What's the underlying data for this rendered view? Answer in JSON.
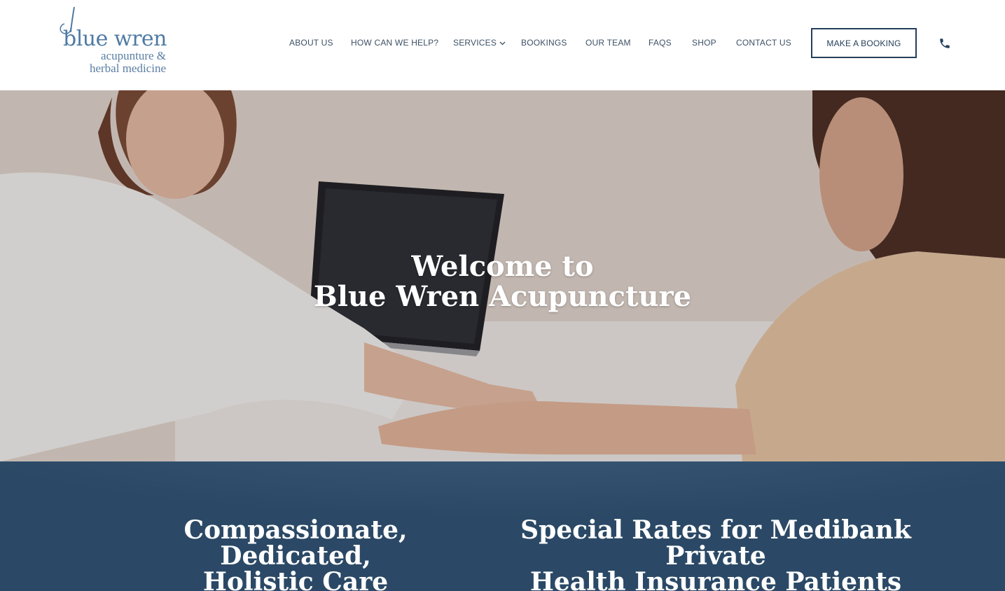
{
  "logo": {
    "title": "blue wren",
    "subtitle_line1": "acupunture &",
    "subtitle_line2": "herbal medicine"
  },
  "nav": {
    "items": [
      {
        "label": "ABOUT US"
      },
      {
        "label": "HOW CAN WE HELP?"
      },
      {
        "label": "SERVICES"
      },
      {
        "label": "BOOKINGS"
      },
      {
        "label": "OUR TEAM"
      },
      {
        "label": "FAQS"
      },
      {
        "label": "SHOP"
      },
      {
        "label": "CONTACT US"
      }
    ],
    "cta_label": "MAKE A BOOKING",
    "phone_icon": "phone-icon",
    "dropdown_icon": "chevron-down-icon"
  },
  "hero": {
    "title_line1": "Welcome to",
    "title_line2": "Blue Wren Acupuncture"
  },
  "band": {
    "left_heading_line1": "Compassionate, Dedicated,",
    "left_heading_line2": "Holistic Care",
    "right_heading_line1": "Special Rates for Medibank Private",
    "right_heading_line2": "Health Insurance Patients"
  },
  "colors": {
    "brand": "#4e7aa4",
    "navy": "#243f5b",
    "band": "#2b4966"
  }
}
